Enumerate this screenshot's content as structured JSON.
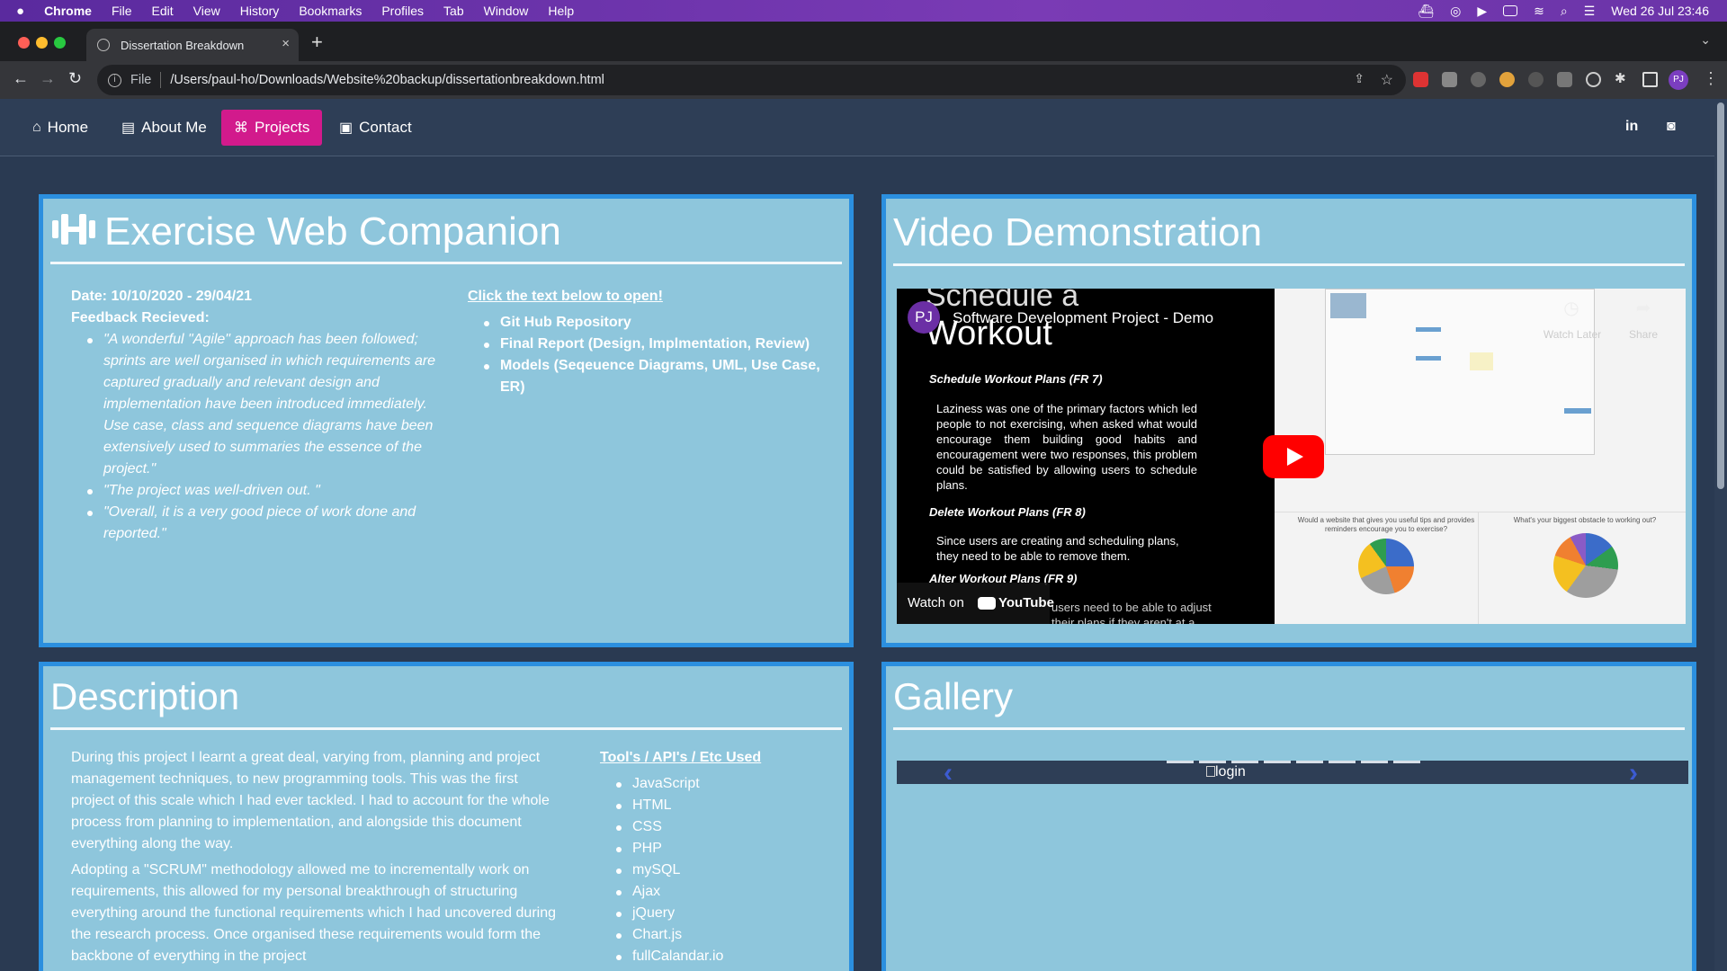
{
  "menubar": {
    "apple": "",
    "app": "Chrome",
    "items": [
      "File",
      "Edit",
      "View",
      "History",
      "Bookmarks",
      "Profiles",
      "Tab",
      "Window",
      "Help"
    ],
    "clock": "Wed 26 Jul  23:46"
  },
  "browser": {
    "tab_title": "Dissertation Breakdown",
    "tab_close": "×",
    "new_tab": "+",
    "url_scheme": "File",
    "url": "/Users/paul-ho/Downloads/Website%20backup/dissertationbreakdown.html",
    "profile_initials": "PJ"
  },
  "sitenav": {
    "home": "Home",
    "about": "About Me",
    "projects": "Projects",
    "contact": "Contact",
    "linkedin": "in",
    "instagram": "◙"
  },
  "project": {
    "title": "Exercise Web Companion",
    "date": "Date: 10/10/2020 - 29/04/21",
    "feedback_heading": "Feedback Recieved:",
    "feedback": [
      "\"A wonderful \"Agile\" approach has been followed; sprints are well organised in which requirements are captured gradually and relevant design and implementation have been introduced immediately. Use case, class and sequence diagrams have been extensively used to summaries the essence of the project.\"",
      "\"The project was well-driven out. \"",
      "\"Overall, it is a very good piece of work done and reported.\""
    ],
    "links_heading": "Click the text below to open!",
    "links": [
      "Git Hub Repository",
      "Final Report (Design, Implmentation, Review)",
      "Models (Seqeuence Diagrams, UML, Use Case, ER)"
    ]
  },
  "video": {
    "heading": "Video Demonstration",
    "channel_initials": "PJ",
    "title": "Software Development Project - Demo",
    "watch_later": "Watch Later",
    "share": "Share",
    "watch_on": "Watch on",
    "youtube": "YouTube",
    "slide_heading_top": "Schedule a",
    "slide_heading": "Workout",
    "slide_item1": "Schedule Workout Plans (FR 7)",
    "slide_text1": "Laziness was one of the primary factors which led people to not exercising, when asked what would encourage them building good habits and encouragement were two responses, this problem could be satisfied by allowing users to schedule plans.",
    "slide_item2": "Delete Workout Plans (FR 8)",
    "slide_text2": "Since users are creating and scheduling plans, they need to be able to remove them.",
    "slide_item3": "Alter Workout Plans (FR 9)",
    "slide_text3": "users need to be able to adjust their plans if they aren't at a desirable",
    "chart_q1": "Would a website that gives you useful tips and provides reminders encourage you to exercise?",
    "chart_q2": "What's your biggest obstacle to working out?"
  },
  "description": {
    "heading": "Description",
    "para1": "During this project I learnt a great deal, varying from, planning and project management techniques, to new programming tools. This was the first project of this scale which I had ever tackled. I had to account for the whole process from planning to implementation, and alongside this document everything along the way.",
    "para2": "Adopting a \"SCRUM\" methodology allowed me to incrementally work on requirements, this allowed for my personal breakthrough of structuring everything around the functional requirements which I had uncovered during the research process. Once organised these requirements would form the backbone of everything in the project",
    "tools_heading": "Tool's / API's / Etc Used",
    "tools": [
      "JavaScript",
      "HTML",
      "CSS",
      "PHP",
      "mySQL",
      "Ajax",
      "jQuery",
      "Chart.js",
      "fullCalandar.io"
    ]
  },
  "gallery": {
    "heading": "Gallery",
    "image_alt": "login",
    "prev": "‹",
    "next": "›",
    "indicator_count": 8
  }
}
